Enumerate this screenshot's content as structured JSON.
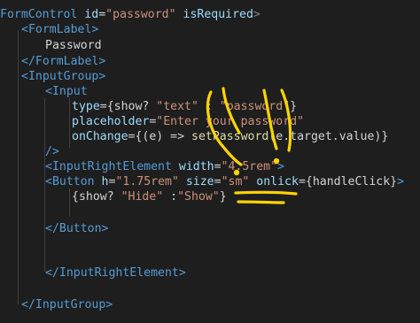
{
  "code": {
    "l1": {
      "open": "FormControl",
      "a1": "id",
      "v1": "\"password\"",
      "a2": "isRequired",
      "close": ">"
    },
    "l2": {
      "tag": "<FormLabel>"
    },
    "l3": {
      "text": "Password"
    },
    "l4": {
      "tag": "</FormLabel>"
    },
    "l5": {
      "tag": "<InputGroup>"
    },
    "l6": {
      "tag": "<Input"
    },
    "l7": {
      "attr": "type",
      "rest": "={show? ",
      "s1": "\"text\"",
      "mid": " : ",
      "s2": "\"password\"",
      "end": "}"
    },
    "l8": {
      "attr": "placeholder",
      "eq": "=",
      "val": "\"Enter your password\""
    },
    "l9": {
      "attr": "onChange",
      "a": "={(e) => ",
      "fn": "setPassword",
      "b": "(e.target.value)}"
    },
    "l10": {
      "tag": "/>"
    },
    "l11": {
      "tag": "<InputRightElement",
      "attr": "width",
      "eq": "=",
      "val": "\"4.5rem\"",
      "end": ">"
    },
    "l12": {
      "tag": "<Button",
      "a1": "h",
      "v1": "\"1.75rem\"",
      "a2": "size",
      "v2": "\"sm\"",
      "a3": "onlick",
      "v3": "={handleClick}",
      "end": ">"
    },
    "l13": {
      "a": "{show? ",
      "s1": "\"Hide\"",
      "mid": " :",
      "s2": "\"Show\"",
      "end": "}"
    },
    "l15": {
      "tag": "</Button>"
    },
    "l18": {
      "tag": "</InputRightElement>"
    },
    "l20": {
      "tag": "</InputGroup>"
    }
  },
  "colors": {
    "background": "#1e1e1e",
    "tag": "#569cd6",
    "attribute": "#9cdcfe",
    "string": "#ce9178",
    "function": "#dcdcaa",
    "annotation": "#ffd400"
  }
}
